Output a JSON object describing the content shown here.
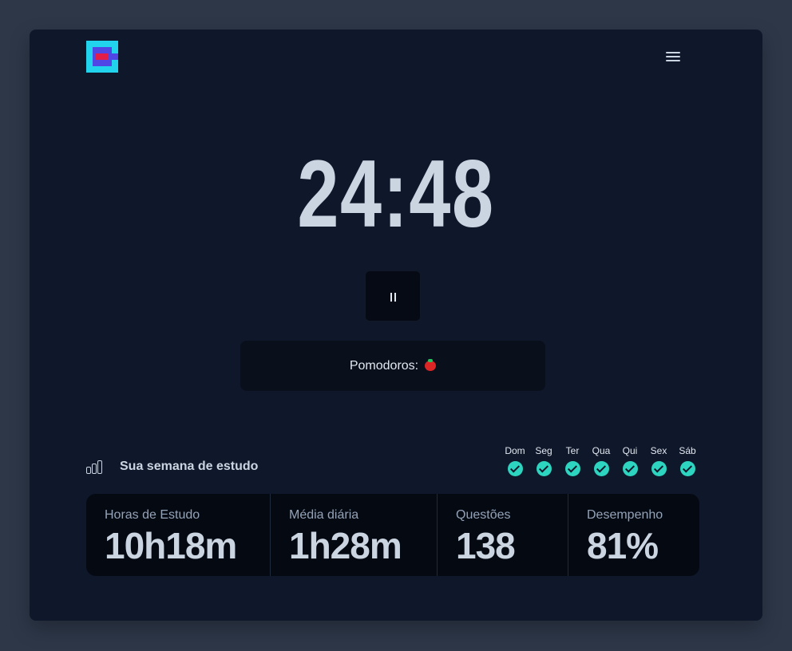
{
  "colors": {
    "background": "#2d3748",
    "card": "#0f172a",
    "accent": "#2dd4bf",
    "logo_primary": "#22d3ee",
    "logo_secondary": "#4f46e5",
    "logo_highlight": "#e11d48"
  },
  "header": {
    "logo_icon": "app-logo",
    "menu_icon": "hamburger-menu-icon"
  },
  "timer": {
    "display": "24:48",
    "control_icon": "pause-icon"
  },
  "pomodoros": {
    "label": "Pomodoros:",
    "icon": "tomato-icon",
    "count": 1
  },
  "week": {
    "title": "Sua semana de estudo",
    "icon": "bar-chart-icon",
    "days": [
      {
        "label": "Dom",
        "done": true
      },
      {
        "label": "Seg",
        "done": true
      },
      {
        "label": "Ter",
        "done": true
      },
      {
        "label": "Qua",
        "done": true
      },
      {
        "label": "Qui",
        "done": true
      },
      {
        "label": "Sex",
        "done": true
      },
      {
        "label": "Sáb",
        "done": true
      }
    ]
  },
  "stats": [
    {
      "label": "Horas de Estudo",
      "value": "10h18m"
    },
    {
      "label": "Média diária",
      "value": "1h28m"
    },
    {
      "label": "Questões",
      "value": "138"
    },
    {
      "label": "Desempenho",
      "value": "81%"
    }
  ]
}
